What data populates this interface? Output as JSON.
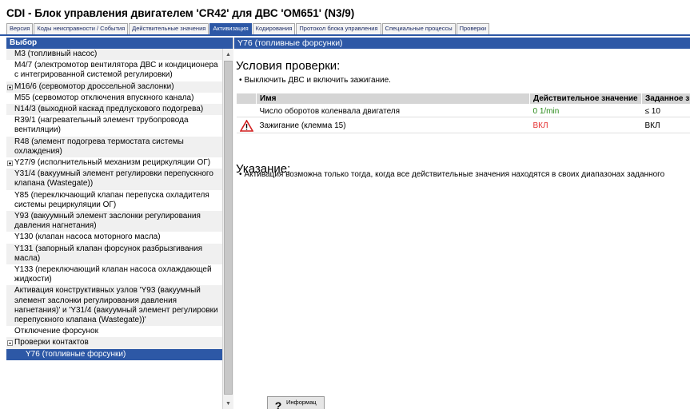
{
  "window": {
    "title": "CDI - Блок управления двигателем 'CR42' для ДВС 'OM651' (N3/9)"
  },
  "tabs": [
    {
      "label": "Версия"
    },
    {
      "label": "Коды неисправности / События"
    },
    {
      "label": "Действительные значения"
    },
    {
      "label": "Активизация",
      "active": true
    },
    {
      "label": "Кодирования"
    },
    {
      "label": "Протокол блока управления"
    },
    {
      "label": "Специальные процессы"
    },
    {
      "label": "Проверки"
    }
  ],
  "sidebar": {
    "header": "Выбор",
    "items": [
      {
        "label": "M3 (топливный насос)"
      },
      {
        "label": "M4/7 (электромотор вентилятора ДВС и кондиционера с интегрированной системой регулировки)"
      },
      {
        "label": "M16/6 (сервомотор дроссельной заслонки)",
        "expander": "closed"
      },
      {
        "label": "M55 (сервомотор отключения впускного канала)"
      },
      {
        "label": "N14/3 (выходной каскад предлускового подогрева)"
      },
      {
        "label": "R39/1 (нагревательный элемент трубопровода вентиляции)"
      },
      {
        "label": "R48 (элемент подогрева термостата системы охлаждения)"
      },
      {
        "label": "Y27/9 (исполнительный механизм рециркуляции ОГ)",
        "expander": "closed"
      },
      {
        "label": "Y31/4 (вакуумный элемент регулировки перепускного клапана (Wastegate))"
      },
      {
        "label": "Y85 (переключающий клапан перепуска охладителя системы рециркуляции ОГ)"
      },
      {
        "label": "Y93 (вакуумный элемент заслонки регулирования давления нагнетания)"
      },
      {
        "label": "Y130 (клапан насоса моторного масла)"
      },
      {
        "label": "Y131 (запорный клапан форсунок разбрызгивания масла)"
      },
      {
        "label": "Y133 (переключающий клапан насоса охлаждающей жидкости)"
      },
      {
        "label": "Активация конструктивных узлов 'Y93 (вакуумный элемент заслонки регулирования давления нагнетания)' и 'Y31/4 (вакуумный элемент регулировки перепускного клапана (Wastegate))'"
      },
      {
        "label": "Отключение форсунок"
      },
      {
        "label": "Проверки контактов",
        "expander": "open"
      },
      {
        "label": "Y76 (топливные форсунки)",
        "sub": true,
        "selected": true
      }
    ]
  },
  "main": {
    "header": "Y76 (топливные форсунки)",
    "conditions_title": "Условия проверки:",
    "conditions_text": "Выключить ДВС и включить зажигание.",
    "table": {
      "columns": [
        "Имя",
        "Действительное значение",
        "Заданное зн"
      ],
      "rows": [
        {
          "name": "Число оборотов коленвала двигателя",
          "actual": "0 1/min",
          "target": "≤ 10",
          "actual_color": "#2a8a1a",
          "warning": false
        },
        {
          "name": "Зажигание (клемма 15)",
          "actual": "ВКЛ",
          "target": "ВКЛ",
          "actual_color": "#e53030",
          "warning": true
        }
      ]
    },
    "hint_title": "Указание:",
    "hint_text": "Активация возможна только тогда, когда все действительные значения находятся в своих диапазонах заданного"
  },
  "footer": {
    "info_label": "Информац",
    "info_icon": "question-icon"
  }
}
